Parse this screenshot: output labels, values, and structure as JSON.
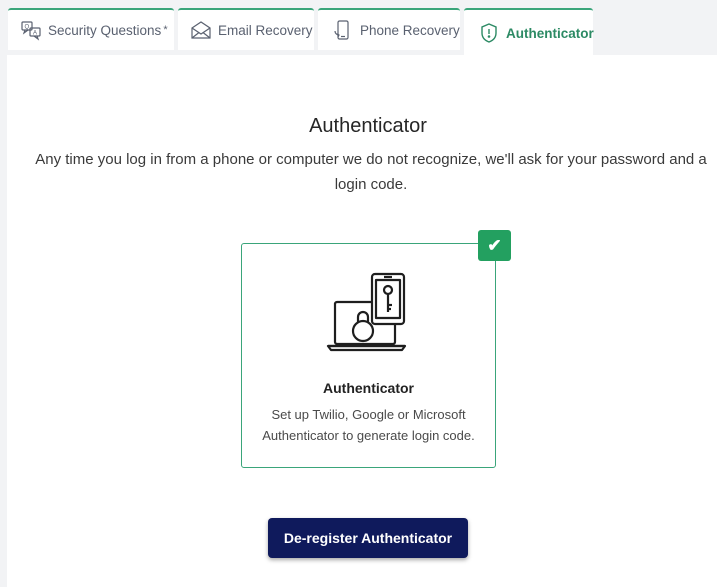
{
  "tabs": [
    {
      "label": "Security Questions",
      "required_mark": "*",
      "icon": "security-questions-icon",
      "active": false
    },
    {
      "label": "Email Recovery",
      "icon": "email-recovery-icon",
      "active": false
    },
    {
      "label": "Phone Recovery",
      "icon": "phone-recovery-icon",
      "active": false
    },
    {
      "label": "Authenticator",
      "icon": "shield-icon",
      "active": true
    }
  ],
  "main": {
    "heading": "Authenticator",
    "description": "Any time you log in from a phone or computer we do not recognize, we'll ask for your password and a login code."
  },
  "card": {
    "checkmark": "✔",
    "illustration": "laptop-phone-key-icon",
    "title": "Authenticator",
    "text": "Set up Twilio, Google or Microsoft Authenticator to generate login code."
  },
  "actions": {
    "deregister_label": "De-register Authenticator"
  },
  "colors": {
    "accent": "#3aa57a",
    "active_tab_text": "#2c8a64",
    "check_badge": "#23a060",
    "button_bg": "#0f1a5c"
  }
}
